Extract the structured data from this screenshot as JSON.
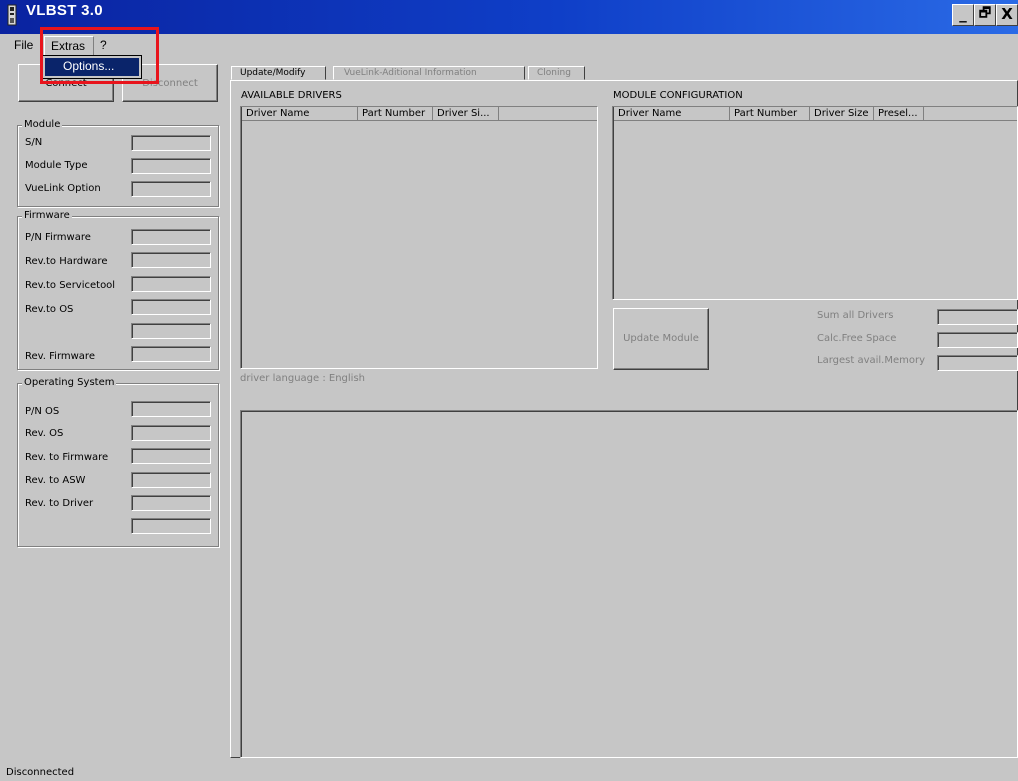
{
  "window": {
    "title": "VLBST 3.0",
    "minimize_glyph": "_",
    "restore_glyph": "🗗",
    "close_glyph": "X"
  },
  "menu": {
    "items": [
      "File",
      "Extras",
      "?"
    ],
    "open_menu": "Extras",
    "dropdown": [
      "Options..."
    ]
  },
  "toolbar": {
    "connect_label": "Connect",
    "disconnect_label": "Disconnect"
  },
  "module_group": {
    "title": "Module",
    "fields": [
      "S/N",
      "Module Type",
      "VueLink Option"
    ]
  },
  "firmware_group": {
    "title": "Firmware",
    "fields": [
      "P/N Firmware",
      "Rev.to Hardware",
      "Rev.to Servicetool",
      "Rev.to OS",
      "",
      "Rev. Firmware"
    ]
  },
  "os_group": {
    "title": "Operating System",
    "fields": [
      "P/N OS",
      "Rev. OS",
      "Rev. to Firmware",
      "Rev. to ASW",
      "Rev. to Driver",
      ""
    ]
  },
  "tabs": [
    "Update/Modify",
    "VueLink-Aditional Information",
    "Cloning"
  ],
  "available_drivers": {
    "heading": "AVAILABLE DRIVERS",
    "columns": [
      "Driver Name",
      "Part Number",
      "Driver Si..."
    ],
    "footer": "driver language : English"
  },
  "module_configuration": {
    "heading": "MODULE CONFIGURATION",
    "columns": [
      "Driver Name",
      "Part Number",
      "Driver Size",
      "Presel..."
    ]
  },
  "update_button": "Update Module",
  "memory": {
    "sum_all_drivers": "Sum all Drivers",
    "calc_free_space": "Calc.Free Space",
    "largest_avail_memory": "Largest avail.Memory"
  },
  "status": "Disconnected",
  "colors": {
    "titlebar": "#0f3fc8",
    "highlight": "#e8141c",
    "menu_selected": "#0a246a"
  }
}
